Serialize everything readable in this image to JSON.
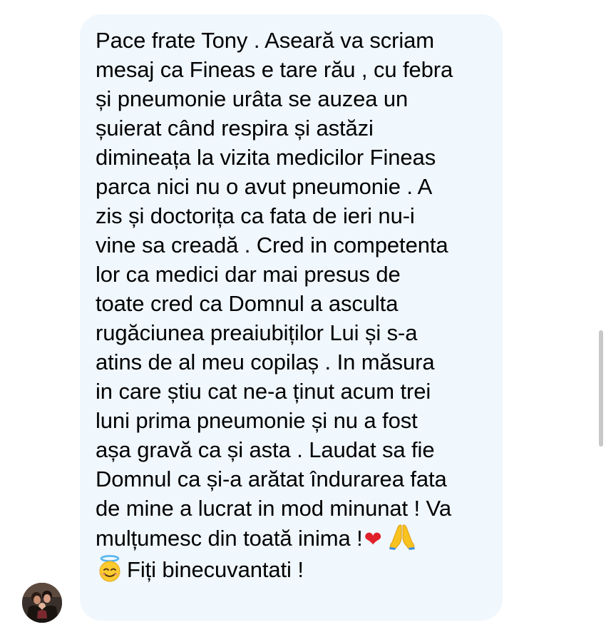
{
  "message": {
    "lines": [
      "Pace frate Tony . Aseară va scriam",
      "mesaj ca Fineas e tare rău , cu febra",
      "și pneumonie urâta se auzea un",
      "șuierat când respira și astăzi",
      "dimineața la vizita medicilor Fineas",
      "parca nici nu o avut pneumonie . A",
      "zis și doctorița ca fata de ieri nu-i",
      "vine sa creadă . Cred in competenta",
      "lor ca medici dar mai presus de",
      "toate cred ca Domnul a asculta",
      "rugăciunea preaiubiților Lui și s-a",
      "atins de al meu copilaș . In măsura",
      "in care știu cat ne-a ținut acum trei",
      "luni prima pneumonie și nu a fost",
      "așa gravă ca și asta . Laudat sa fie",
      "Domnul ca și-a arătat îndurarea fata",
      "de mine a lucrat in mod minunat ! Va",
      "mulțumesc din toată inima !"
    ],
    "heart_emoji": "❤",
    "last_line": "Fiți binecuvantati !"
  },
  "colors": {
    "bubble_background": "#f0f7fd",
    "text": "#000000",
    "heart": "#e0202b",
    "scrollbar": "#c8c8c8"
  },
  "icons": {
    "heart": "red-heart-icon",
    "prayer": "folded-hands-icon",
    "angel": "smiling-face-with-halo-icon",
    "avatar": "user-avatar"
  }
}
